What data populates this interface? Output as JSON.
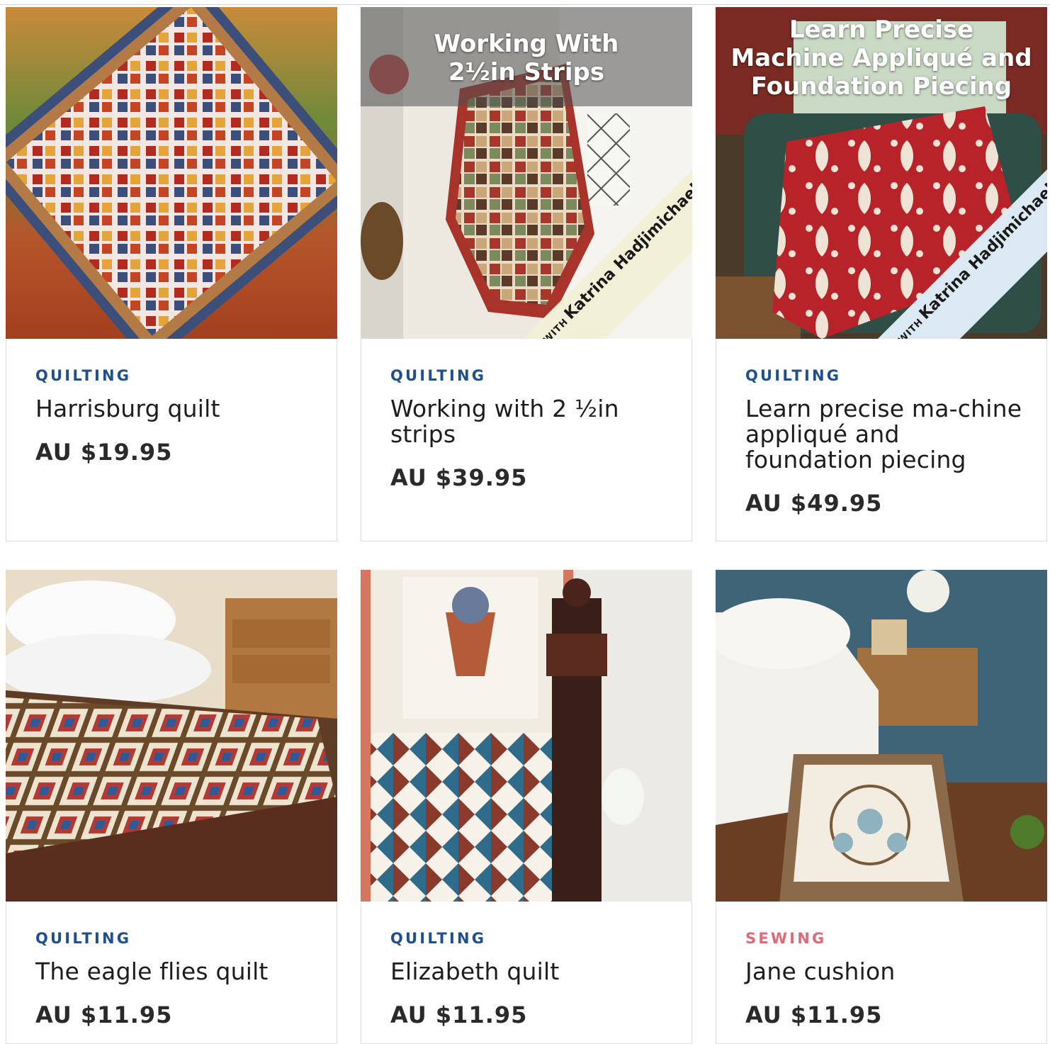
{
  "products": [
    {
      "category": "QUILTING",
      "category_color": "#1f4f8f",
      "title": "Harrisburg quilt",
      "price": "AU $19.95",
      "image_icon": "quilt-photo"
    },
    {
      "category": "QUILTING",
      "category_color": "#1f4f8f",
      "title": "Working with 2 ½in strips",
      "price": "AU $39.95",
      "image_icon": "quilt-photo",
      "overlay_title": "Working With\n2½in Strips",
      "ribbon_with": "WITH",
      "ribbon_name": "Katrina Hadjimichael"
    },
    {
      "category": "QUILTING",
      "category_color": "#1f4f8f",
      "title": "Learn precise ma-chine appliqué and foundation piecing",
      "price": "AU $49.95",
      "image_icon": "quilt-photo",
      "overlay_title": "Learn Precise\nMachine Appliqué and\nFoundation Piecing",
      "ribbon_with": "WITH",
      "ribbon_name": "Katrina Hadjimichael"
    },
    {
      "category": "QUILTING",
      "category_color": "#1f4f8f",
      "title": "The eagle flies quilt",
      "price": "AU $11.95",
      "image_icon": "quilt-photo"
    },
    {
      "category": "QUILTING",
      "category_color": "#1f4f8f",
      "title": "Elizabeth quilt",
      "price": "AU $11.95",
      "image_icon": "quilt-photo"
    },
    {
      "category": "SEWING",
      "category_color": "#e06b78",
      "title": "Jane cushion",
      "price": "AU $11.95",
      "image_icon": "cushion-photo"
    }
  ]
}
